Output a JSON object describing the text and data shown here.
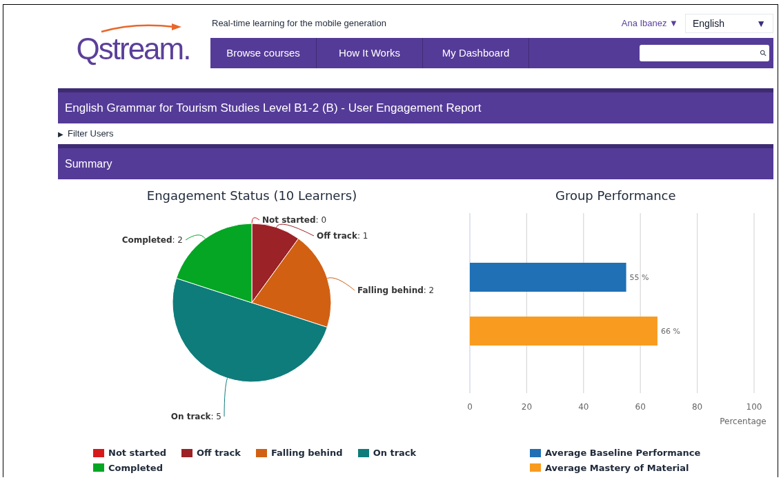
{
  "logo": {
    "text": "Qstream."
  },
  "tagline": "Real-time learning for the mobile generation",
  "user_menu": "Ana Ibanez ▼",
  "language_select": {
    "value": "English",
    "arrow": "▼"
  },
  "nav": [
    {
      "label": "Browse courses"
    },
    {
      "label": "How It Works"
    },
    {
      "label": "My Dashboard"
    }
  ],
  "search": {
    "icon": "⚲"
  },
  "report_title": "English Grammar for Tourism Studies Level B1-2 (B) - User Engagement Report",
  "filter": {
    "arrow": "▶",
    "label": "Filter Users",
    "expanded": false
  },
  "summary_title": "Summary",
  "engagement_chart": {
    "chart_data": {
      "type": "pie",
      "title": "Engagement Status (10 Learners)",
      "values": [
        0,
        1,
        2,
        5,
        2
      ],
      "value_labels": [
        "**Not started**: 0",
        "**Off track**: 1",
        "**Falling behind**: 2",
        "**On track**: 5",
        "**Completed**: 2"
      ]
    },
    "legend": [
      {
        "label": "Not started",
        "color": "#d7191c"
      },
      {
        "label": "Off track",
        "color": "#9b2226"
      },
      {
        "label": "Falling behind",
        "color": "#d16013"
      },
      {
        "label": "On track",
        "color": "#0e7c7b"
      },
      {
        "label": "Completed",
        "color": "#04a624"
      }
    ]
  },
  "performance_chart": {
    "chart_data": {
      "type": "bar",
      "orientation": "horizontal",
      "grid": true,
      "title": "Group Performance",
      "xlabel": "Percentage",
      "xlim": [
        0,
        100
      ],
      "xticks": [
        0,
        20,
        40,
        60,
        80,
        100
      ],
      "series": [
        {
          "name": "Average Baseline Performance",
          "color": "#1f70b4",
          "values": [
            55
          ]
        },
        {
          "name": "Average Mastery of Material",
          "color": "#f99b1f",
          "values": [
            66
          ]
        }
      ],
      "value_labels": [
        "55 %",
        "66 %"
      ]
    }
  }
}
